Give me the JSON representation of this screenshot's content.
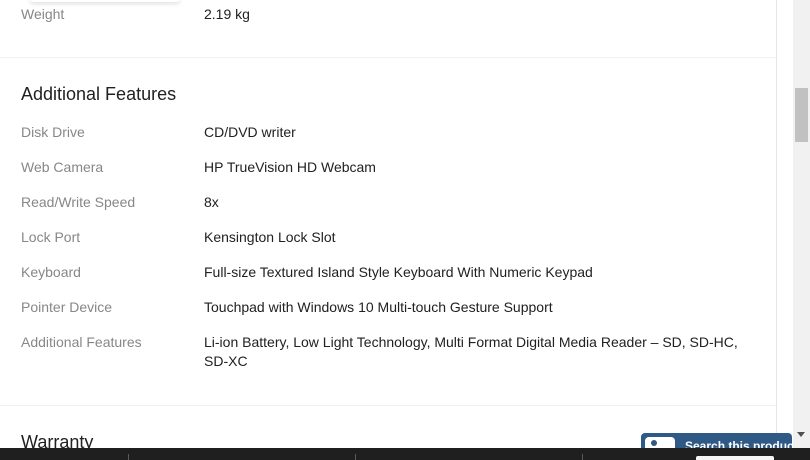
{
  "top_row": {
    "label": "Weight",
    "value": "2.19 kg"
  },
  "additional_features": {
    "title": "Additional Features",
    "rows": [
      {
        "label": "Disk Drive",
        "value": "CD/DVD writer"
      },
      {
        "label": "Web Camera",
        "value": "HP TrueVision HD Webcam"
      },
      {
        "label": "Read/Write Speed",
        "value": "8x"
      },
      {
        "label": "Lock Port",
        "value": "Kensington Lock Slot"
      },
      {
        "label": "Keyboard",
        "value": "Full-size Textured Island Style Keyboard With Numeric Keypad"
      },
      {
        "label": "Pointer Device",
        "value": "Touchpad with Windows 10 Multi-touch Gesture Support"
      },
      {
        "label": "Additional Features",
        "value": "Li-ion Battery, Low Light Technology, Multi Format Digital Media Reader – SD, SD-HC, SD-XC"
      }
    ]
  },
  "warranty": {
    "title": "Warranty"
  },
  "search_widget": {
    "label": "Search this product",
    "icon": "camera-icon"
  }
}
